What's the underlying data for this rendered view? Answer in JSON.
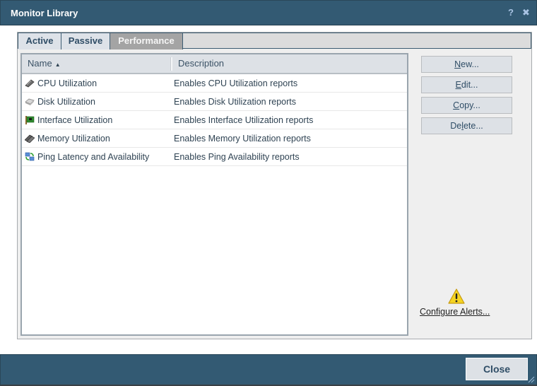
{
  "window": {
    "title": "Monitor Library",
    "help_icon": "?",
    "close_icon": "✖"
  },
  "tabs": [
    {
      "label": "Active",
      "selected": false
    },
    {
      "label": "Passive",
      "selected": false
    },
    {
      "label": "Performance",
      "selected": true
    }
  ],
  "table": {
    "columns": [
      {
        "label": "Name",
        "sort": "ascending"
      },
      {
        "label": "Description"
      }
    ],
    "sort_arrow": "▲",
    "rows": [
      {
        "name": "CPU Utilization",
        "description": "Enables CPU Utilization reports",
        "icon": "cpu-chip-icon"
      },
      {
        "name": "Disk Utilization",
        "description": "Enables Disk Utilization reports",
        "icon": "disk-drive-icon"
      },
      {
        "name": "Interface Utilization",
        "description": "Enables Interface Utilization reports",
        "icon": "network-card-icon"
      },
      {
        "name": "Memory Utilization",
        "description": "Enables Memory Utilization reports",
        "icon": "memory-module-icon"
      },
      {
        "name": "Ping Latency and Availability",
        "description": "Enables Ping Availability reports",
        "icon": "ping-network-icon"
      }
    ]
  },
  "actions": {
    "new": {
      "mnemonic": "N",
      "rest": "ew..."
    },
    "edit": {
      "mnemonic": "E",
      "rest": "dit..."
    },
    "copy": {
      "mnemonic": "C",
      "rest": "opy..."
    },
    "delete": {
      "pre": "De",
      "mnemonic": "l",
      "rest": "ete..."
    }
  },
  "alerts": {
    "icon": "warning-icon",
    "link_label": "Configure Alerts..."
  },
  "footer": {
    "close_label": "Close"
  }
}
